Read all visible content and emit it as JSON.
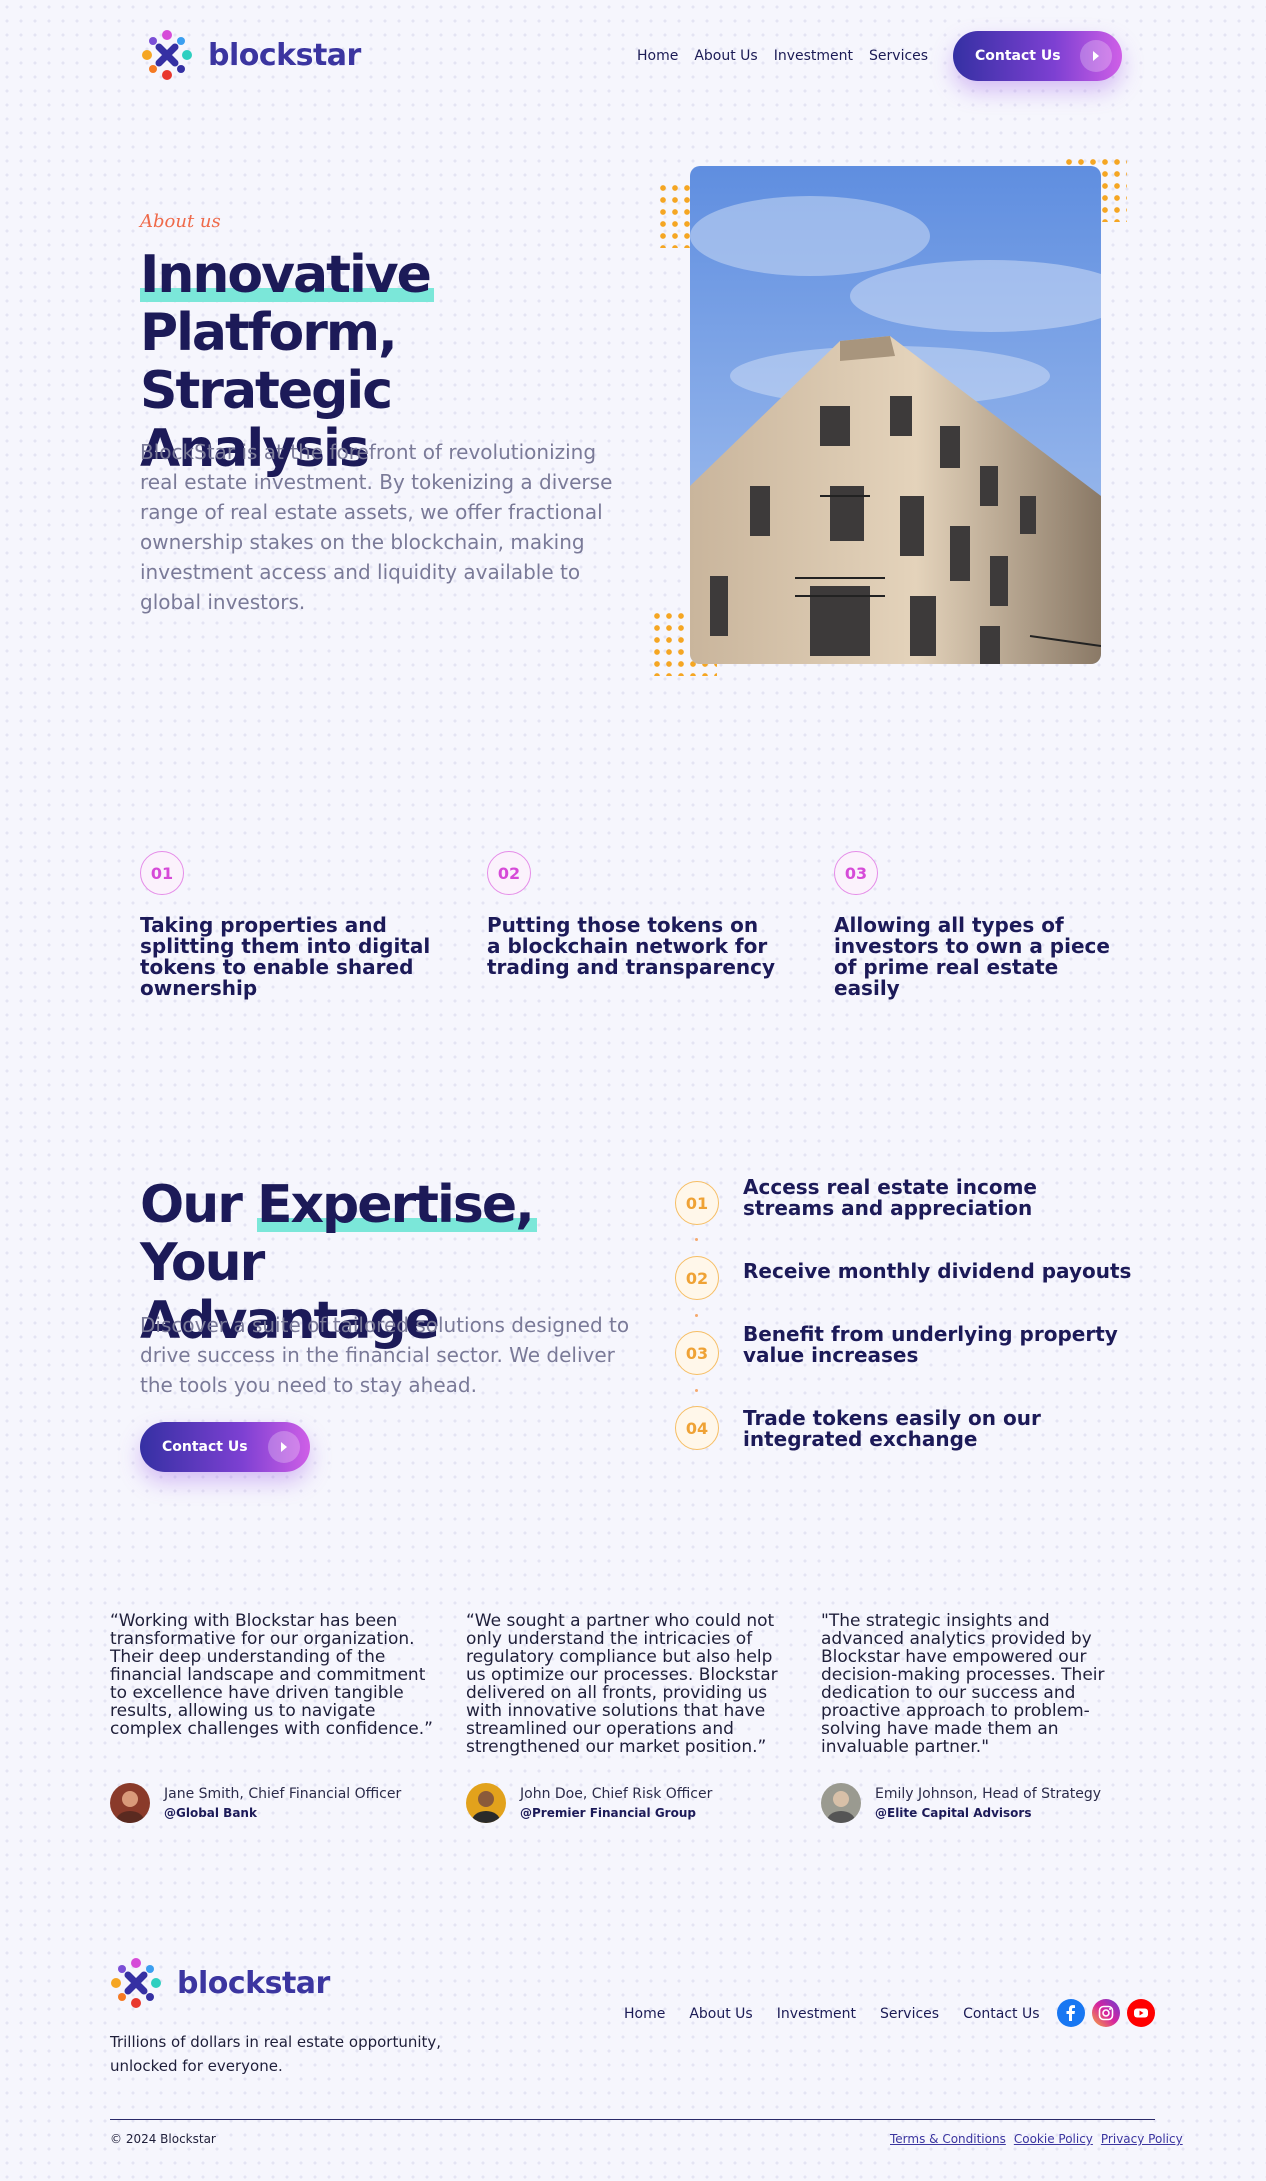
{
  "brand": {
    "name": "blockstar"
  },
  "header": {
    "nav": [
      "Home",
      "About Us",
      "Investment",
      "Services"
    ],
    "contact_label": "Contact Us"
  },
  "hero": {
    "eyebrow": "About us",
    "title_highlight": "Innovative",
    "title_line2": "Platform, Strategic",
    "title_line3": "Analysis",
    "description": "BlockStar is at the forefront of revolutionizing real estate investment. By tokenizing a diverse range of real estate assets, we offer fractional ownership stakes on the blockchain, making investment access and liquidity available to global investors."
  },
  "steps": [
    {
      "num": "01",
      "text": "Taking properties and splitting them into digital tokens to enable shared ownership"
    },
    {
      "num": "02",
      "text": "Putting those tokens on a blockchain network for trading and transparency"
    },
    {
      "num": "03",
      "text": "Allowing all types of investors to own a piece of prime real estate easily"
    }
  ],
  "expertise": {
    "title_part1": "Our",
    "title_highlight": "Expertise,",
    "title_part2": "Your",
    "title_line2": "Advantage",
    "description": "Discover a suite of tailored solutions designed to drive success in the financial sector. We deliver the tools you need to stay ahead.",
    "contact_label": "Contact Us",
    "advantages": [
      {
        "num": "01",
        "text": "Access real estate income streams and appreciation"
      },
      {
        "num": "02",
        "text": "Receive monthly dividend payouts"
      },
      {
        "num": "03",
        "text": "Benefit from underlying property value increases"
      },
      {
        "num": "04",
        "text": "Trade tokens easily on our integrated exchange"
      }
    ]
  },
  "testimonials": [
    {
      "quote": "“Working with Blockstar has been transformative for our organization. Their deep understanding of the financial landscape and commitment to excellence have driven tangible results, allowing us to navigate complex challenges with confidence.”",
      "name": "Jane Smith, Chief Financial Officer",
      "org": "@Global Bank",
      "avatar_color": "#8a3a2a"
    },
    {
      "quote": "“We sought a partner who could not only understand the intricacies of regulatory compliance but also help us optimize our processes. Blockstar delivered on all fronts, providing us with innovative solutions that have streamlined our operations and strengthened our market position.”",
      "name": "John Doe, Chief Risk Officer",
      "org": "@Premier Financial Group",
      "avatar_color": "#e2a21c"
    },
    {
      "quote": "\"The strategic insights and advanced analytics provided by Blockstar have empowered our decision-making processes. Their dedication to our success and proactive approach to problem-solving have made them an invaluable partner.\"",
      "name": "Emily Johnson, Head of Strategy",
      "org": "@Elite Capital Advisors",
      "avatar_color": "#8c8c80"
    }
  ],
  "footer": {
    "tagline": "Trillions of dollars in real estate opportunity, unlocked for everyone.",
    "nav": [
      "Home",
      "About Us",
      "Investment",
      "Services",
      "Contact Us"
    ],
    "copyright": "© 2024 Blockstar",
    "legal": [
      "Terms & Conditions",
      "Cookie Policy",
      "Privacy Policy"
    ],
    "social": [
      {
        "icon": "facebook-icon",
        "color": "#1877f2"
      },
      {
        "icon": "instagram-icon",
        "color": "#d6249f"
      },
      {
        "icon": "youtube-icon",
        "color": "#ff0000"
      }
    ]
  },
  "colors": {
    "primary": "#3530a3",
    "accent_purple": "#cf5fe7",
    "highlight": "#7be7d9",
    "orange": "#f5a623",
    "heading": "#1c1a58"
  }
}
